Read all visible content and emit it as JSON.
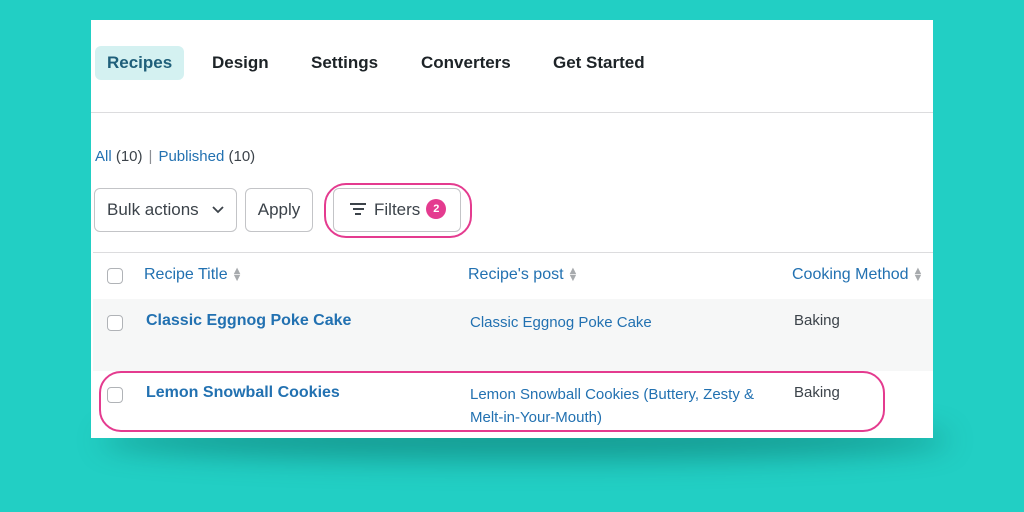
{
  "tabs": [
    {
      "label": "Recipes",
      "active": true
    },
    {
      "label": "Design"
    },
    {
      "label": "Settings"
    },
    {
      "label": "Converters"
    },
    {
      "label": "Get Started"
    }
  ],
  "views": {
    "all": {
      "label": "All",
      "count": "(10)"
    },
    "published": {
      "label": "Published",
      "count": "(10)"
    },
    "separator": "|"
  },
  "toolbar": {
    "bulk_actions_label": "Bulk actions",
    "apply_label": "Apply",
    "filters_label": "Filters",
    "filters_count": "2"
  },
  "table": {
    "columns": [
      "Recipe Title",
      "Recipe's post",
      "Cooking Method"
    ],
    "rows": [
      {
        "title": "Classic Eggnog Poke Cake",
        "post": "Classic Eggnog Poke Cake",
        "method": "Baking"
      },
      {
        "title": "Lemon Snowball Cookies",
        "post": "Lemon Snowball Cookies (Buttery, Zesty & Melt-in-Your-Mouth)",
        "method": "Baking"
      }
    ]
  },
  "colors": {
    "background": "#22cfc4",
    "highlight": "#e43b8f",
    "link": "#2271b1",
    "active_tab_bg": "#d4f1f1"
  },
  "icons": [
    "chevron-down-icon",
    "filter-lines-icon",
    "sort-arrows-icon",
    "checkbox-icon"
  ]
}
